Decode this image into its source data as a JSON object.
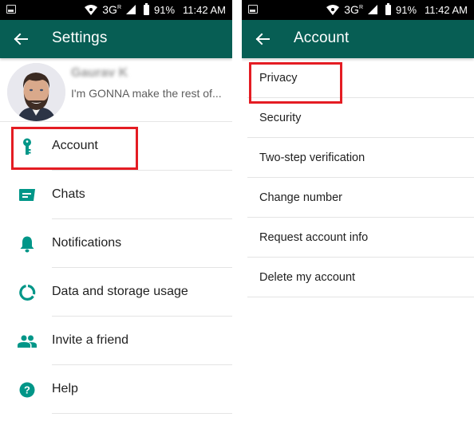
{
  "colors": {
    "primary": "#075e54",
    "accent_icon": "#009688",
    "highlight": "#e41c23",
    "statusbar": "#000000"
  },
  "status_bar": {
    "network": "3G",
    "network_sup": "R",
    "battery": "91%",
    "time": "11:42 AM",
    "icons": [
      "image-notification-icon",
      "wifi-icon",
      "signal-icon",
      "battery-icon"
    ]
  },
  "settings_screen": {
    "title": "Settings",
    "back_icon": "arrow-left-icon",
    "profile": {
      "name": "Gaurav K",
      "status": "I'm GONNA make the rest of..."
    },
    "items": [
      {
        "label": "Account",
        "icon": "key-icon",
        "highlighted": true
      },
      {
        "label": "Chats",
        "icon": "chat-icon"
      },
      {
        "label": "Notifications",
        "icon": "bell-icon"
      },
      {
        "label": "Data and storage usage",
        "icon": "data-usage-icon"
      },
      {
        "label": "Invite a friend",
        "icon": "people-icon"
      },
      {
        "label": "Help",
        "icon": "help-icon"
      }
    ]
  },
  "account_screen": {
    "title": "Account",
    "back_icon": "arrow-left-icon",
    "items": [
      {
        "label": "Privacy",
        "highlighted": true
      },
      {
        "label": "Security"
      },
      {
        "label": "Two-step verification"
      },
      {
        "label": "Change number"
      },
      {
        "label": "Request account info"
      },
      {
        "label": "Delete my account"
      }
    ]
  }
}
